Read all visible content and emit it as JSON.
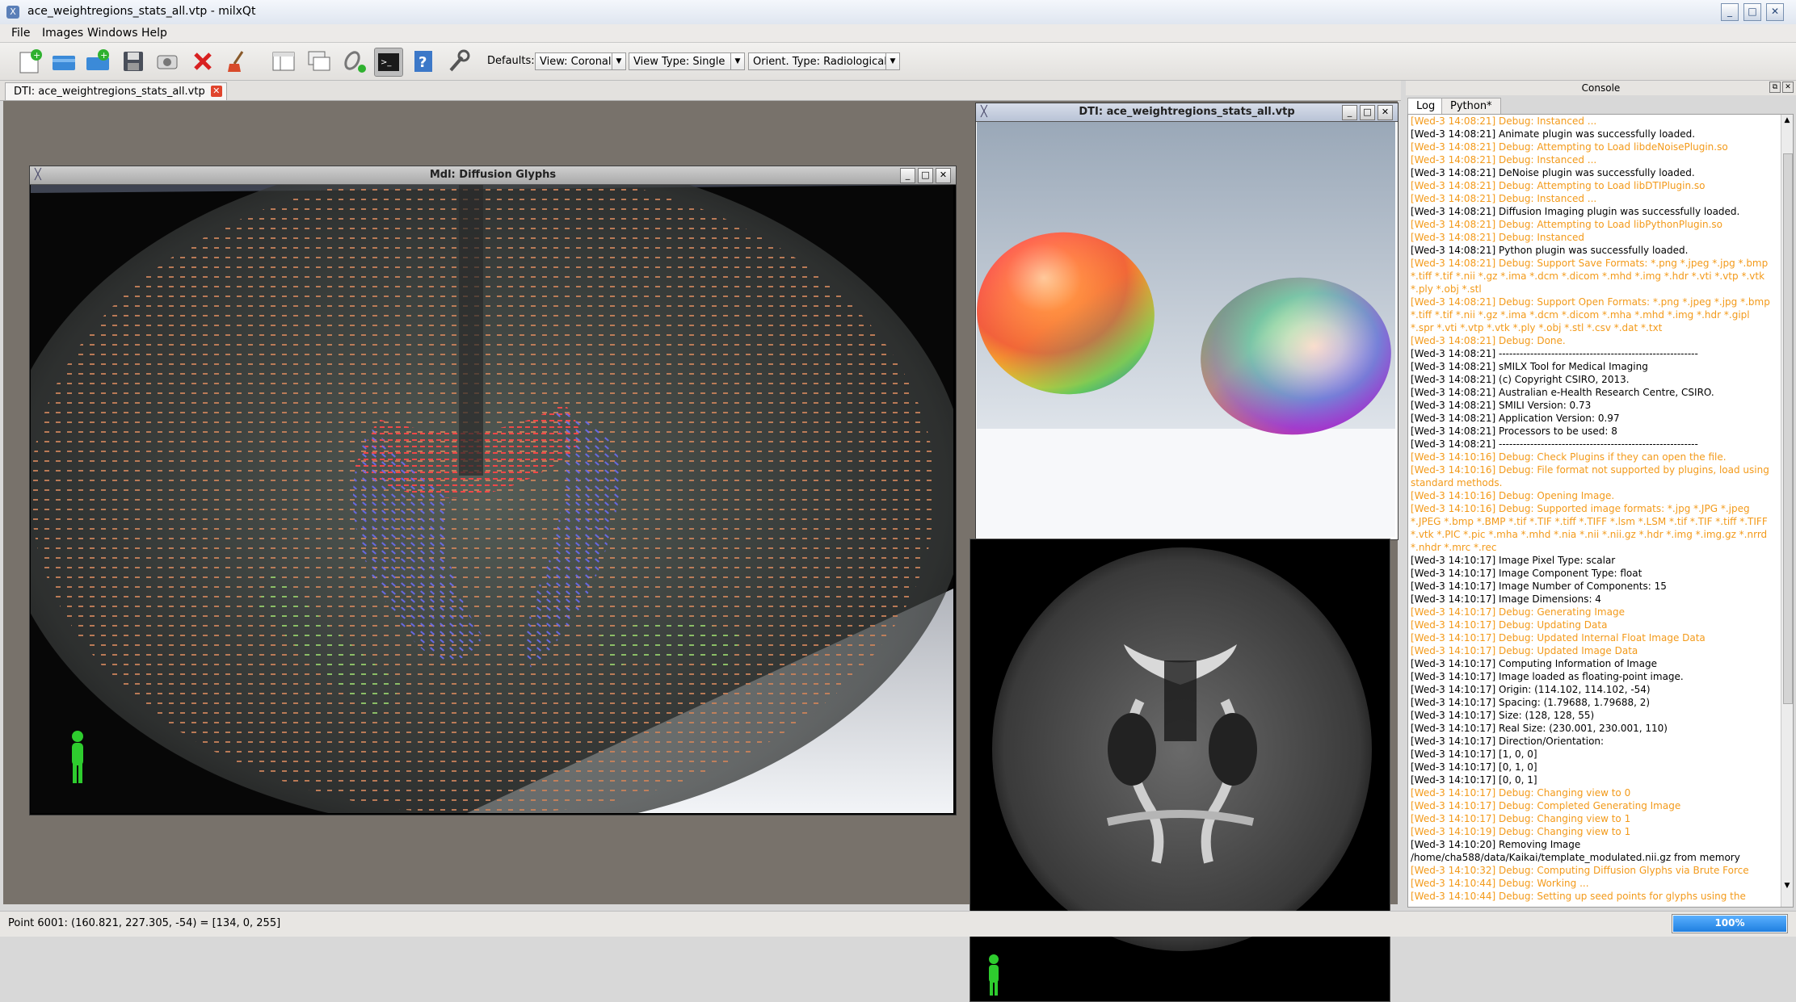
{
  "window": {
    "title": "ace_weightregions_stats_all.vtp - milxQt"
  },
  "menu": [
    "File",
    "Images",
    "Windows",
    "Help"
  ],
  "toolbar": {
    "defaults_label": "Defaults:",
    "view": "View: Coronal",
    "view_type": "View Type: Single",
    "orient": "Orient. Type: Radiological"
  },
  "doc_tab": {
    "label": "DTI: ace_weightregions_stats_all.vtp"
  },
  "subwindows": {
    "glyphs": {
      "title": "Mdl: Diffusion Glyphs"
    },
    "odf": {
      "title": "DTI: ace_weightregions_stats_all.vtp"
    }
  },
  "console": {
    "title": "Console",
    "tabs": [
      "Log",
      "Python*"
    ],
    "lines": [
      {
        "text": "[Wed-3 14:08:21] Debug: Instanced ...",
        "level": "debug"
      },
      {
        "text": "[Wed-3 14:08:21] Animate plugin was successfully loaded.",
        "level": "info"
      },
      {
        "text": "[Wed-3 14:08:21] Debug: Attempting to Load libdeNoisePlugin.so",
        "level": "debug"
      },
      {
        "text": "[Wed-3 14:08:21] Debug: Instanced ...",
        "level": "debug"
      },
      {
        "text": "[Wed-3 14:08:21] DeNoise plugin was successfully loaded.",
        "level": "info"
      },
      {
        "text": "[Wed-3 14:08:21] Debug: Attempting to Load libDTIPlugin.so",
        "level": "debug"
      },
      {
        "text": "[Wed-3 14:08:21] Debug: Instanced ...",
        "level": "debug"
      },
      {
        "text": "[Wed-3 14:08:21] Diffusion Imaging plugin was successfully loaded.",
        "level": "info"
      },
      {
        "text": "[Wed-3 14:08:21] Debug: Attempting to Load libPythonPlugin.so",
        "level": "debug"
      },
      {
        "text": "[Wed-3 14:08:21] Debug: Instanced",
        "level": "debug"
      },
      {
        "text": "[Wed-3 14:08:21] Python plugin was successfully loaded.",
        "level": "info"
      },
      {
        "text": "[Wed-3 14:08:21] Debug: Support Save Formats: *.png *.jpeg *.jpg *.bmp *.tiff *.tif *.nii *.gz *.ima *.dcm *.dicom *.mhd *.img *.hdr *.vti *.vtp *.vtk *.ply *.obj *.stl",
        "level": "debug"
      },
      {
        "text": "[Wed-3 14:08:21] Debug: Support Open Formats: *.png *.jpeg *.jpg *.bmp *.tiff *.tif *.nii *.gz *.ima *.dcm *.dicom *.mha *.mhd *.img *.hdr *.gipl *.spr *.vti *.vtp *.vtk *.ply *.obj *.stl *.csv *.dat *.txt",
        "level": "debug"
      },
      {
        "text": "[Wed-3 14:08:21] Debug: Done.",
        "level": "debug"
      },
      {
        "text": "[Wed-3 14:08:21] ---------------------------------------------------------",
        "level": "info"
      },
      {
        "text": "[Wed-3 14:08:21] sMILX Tool for Medical Imaging",
        "level": "info"
      },
      {
        "text": "[Wed-3 14:08:21] (c) Copyright CSIRO, 2013.",
        "level": "info"
      },
      {
        "text": "[Wed-3 14:08:21] Australian e-Health Research Centre, CSIRO.",
        "level": "info"
      },
      {
        "text": "[Wed-3 14:08:21] SMILI Version: 0.73",
        "level": "info"
      },
      {
        "text": "[Wed-3 14:08:21] Application Version: 0.97",
        "level": "info"
      },
      {
        "text": "[Wed-3 14:08:21] Processors to be used: 8",
        "level": "info"
      },
      {
        "text": "[Wed-3 14:08:21] ---------------------------------------------------------",
        "level": "info"
      },
      {
        "text": "[Wed-3 14:10:16] Debug: Check Plugins if they can open the file.",
        "level": "debug"
      },
      {
        "text": "[Wed-3 14:10:16] Debug: File format not supported by plugins, load using standard methods.",
        "level": "debug"
      },
      {
        "text": "[Wed-3 14:10:16] Debug: Opening Image.",
        "level": "debug"
      },
      {
        "text": "[Wed-3 14:10:16] Debug: Supported image formats: *.jpg *.JPG *.jpeg *.JPEG *.bmp *.BMP *.tif *.TIF *.tiff *.TIFF *.lsm *.LSM *.tif *.TIF *.tiff *.TIFF *.vtk *.PIC *.pic *.mha *.mhd *.nia *.nii *.nii.gz *.hdr *.img *.img.gz *.nrrd *.nhdr *.mrc *.rec",
        "level": "debug"
      },
      {
        "text": "[Wed-3 14:10:17] Image Pixel Type: scalar",
        "level": "info"
      },
      {
        "text": "[Wed-3 14:10:17] Image Component Type: float",
        "level": "info"
      },
      {
        "text": "[Wed-3 14:10:17] Image Number of Components: 15",
        "level": "info"
      },
      {
        "text": "[Wed-3 14:10:17] Image Dimensions: 4",
        "level": "info"
      },
      {
        "text": "[Wed-3 14:10:17] Debug: Generating Image",
        "level": "debug"
      },
      {
        "text": "[Wed-3 14:10:17] Debug: Updating Data",
        "level": "debug"
      },
      {
        "text": "[Wed-3 14:10:17] Debug: Updated Internal Float Image Data",
        "level": "debug"
      },
      {
        "text": "[Wed-3 14:10:17] Debug: Updated Image Data",
        "level": "debug"
      },
      {
        "text": "[Wed-3 14:10:17] Computing Information of Image",
        "level": "info"
      },
      {
        "text": "[Wed-3 14:10:17] Image loaded as floating-point image.",
        "level": "info"
      },
      {
        "text": "[Wed-3 14:10:17] Origin: (114.102, 114.102, -54)",
        "level": "info"
      },
      {
        "text": "[Wed-3 14:10:17] Spacing: (1.79688, 1.79688, 2)",
        "level": "info"
      },
      {
        "text": "[Wed-3 14:10:17] Size: (128, 128, 55)",
        "level": "info"
      },
      {
        "text": "[Wed-3 14:10:17] Real Size: (230.001, 230.001, 110)",
        "level": "info"
      },
      {
        "text": "[Wed-3 14:10:17] Direction/Orientation:",
        "level": "info"
      },
      {
        "text": "[Wed-3 14:10:17] [1, 0, 0]",
        "level": "info"
      },
      {
        "text": "[Wed-3 14:10:17] [0, 1, 0]",
        "level": "info"
      },
      {
        "text": "[Wed-3 14:10:17] [0, 0, 1]",
        "level": "info"
      },
      {
        "text": "[Wed-3 14:10:17] Debug: Changing view to 0",
        "level": "debug"
      },
      {
        "text": "[Wed-3 14:10:17] Debug: Completed Generating Image",
        "level": "debug"
      },
      {
        "text": "[Wed-3 14:10:17] Debug: Changing view to 1",
        "level": "debug"
      },
      {
        "text": "[Wed-3 14:10:19] Debug: Changing view to 1",
        "level": "debug"
      },
      {
        "text": "[Wed-3 14:10:20] Removing Image /home/cha588/data/Kaikai/template_modulated.nii.gz from memory",
        "level": "info"
      },
      {
        "text": "[Wed-3 14:10:32] Debug: Computing Diffusion Glyphs via Brute Force",
        "level": "debug"
      },
      {
        "text": "[Wed-3 14:10:44] Debug: Working ...",
        "level": "debug"
      },
      {
        "text": "[Wed-3 14:10:44] Debug: Setting up seed points for glyphs using the",
        "level": "debug"
      }
    ]
  },
  "status": {
    "text": "Point 6001: (160.821, 227.305, -54) = [134, 0, 255]",
    "progress": 1.0,
    "progress_label": "100%"
  }
}
